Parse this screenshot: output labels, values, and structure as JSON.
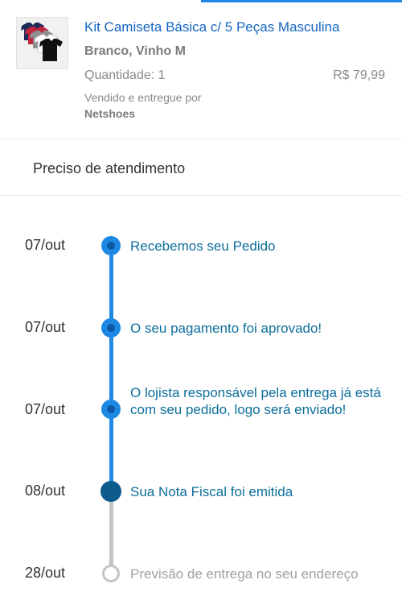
{
  "product": {
    "title": "Kit Camiseta Básica c/ 5 Peças Masculina",
    "variant": "Branco, Vinho M",
    "quantity": "Quantidade: 1",
    "price": "R$ 79,99",
    "sold_by": "Vendido e entregue por",
    "seller": "Netshoes"
  },
  "help": {
    "label": "Preciso de atendimento"
  },
  "timeline": [
    {
      "date": "07/out",
      "text": "Recebemos seu Pedido",
      "status": "done"
    },
    {
      "date": "07/out",
      "text": "O seu pagamento foi aprovado!",
      "status": "done"
    },
    {
      "date": "07/out",
      "text": "O lojista responsável pela entrega já está com seu pedido, logo será enviado!",
      "status": "done"
    },
    {
      "date": "08/out",
      "text": "Sua Nota Fiscal foi emitida",
      "status": "current"
    },
    {
      "date": "28/out",
      "text": "Previsão de entrega no seu endereço",
      "status": "pending"
    }
  ],
  "colors": {
    "accent": "#1e88e5",
    "current": "#0d5a8c",
    "pending": "#c4c4c4",
    "step_text": "#0d6e9c"
  }
}
